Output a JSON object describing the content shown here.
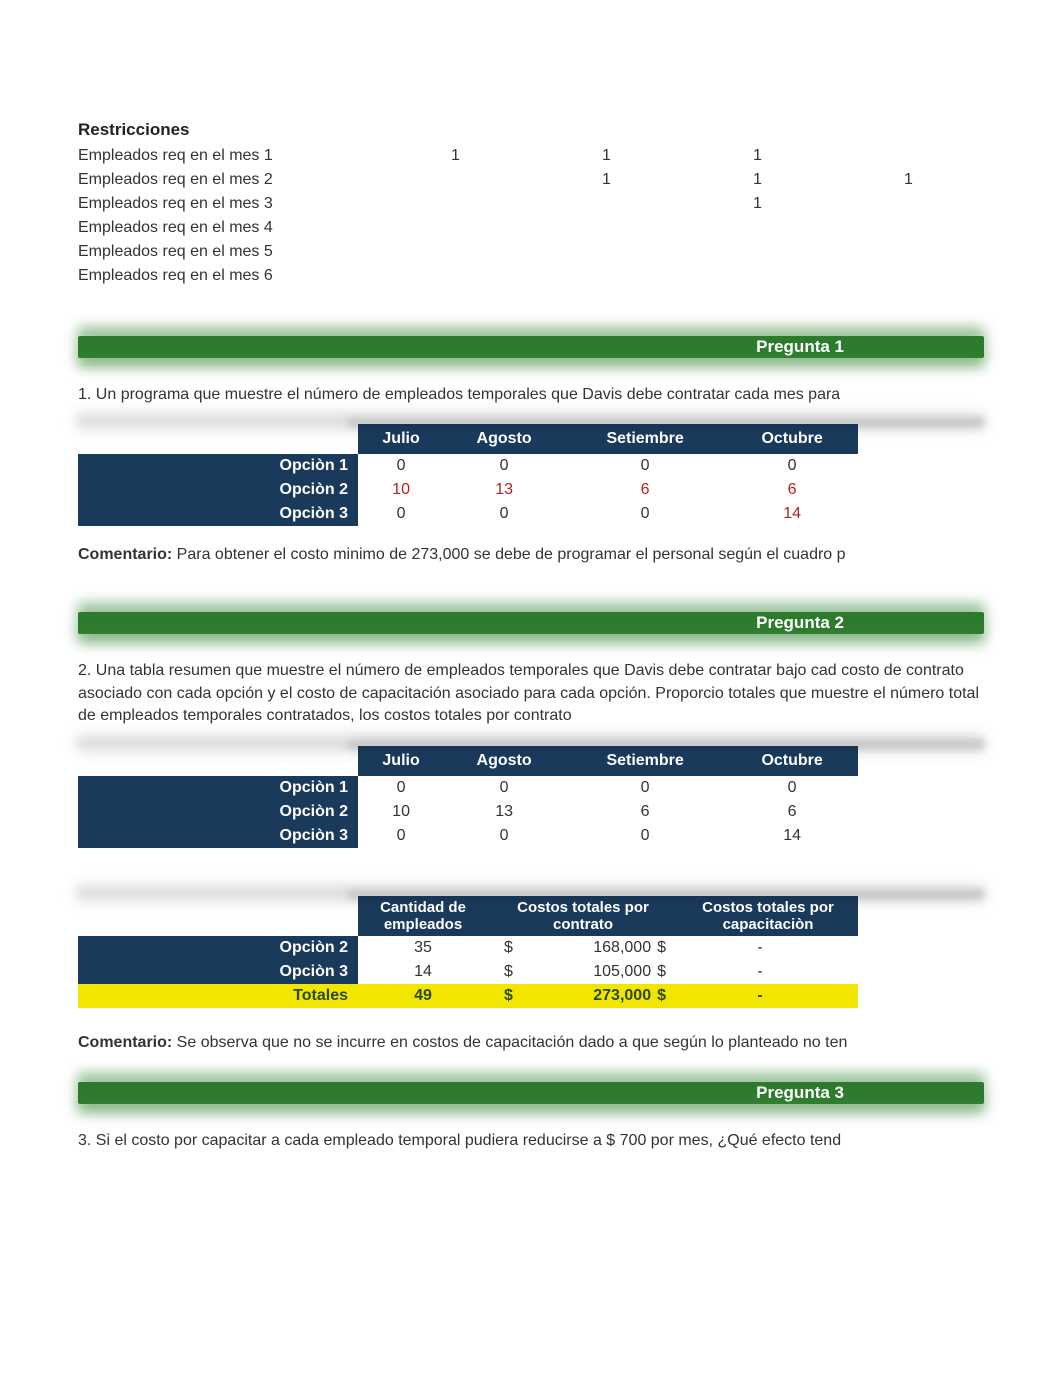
{
  "restricciones": {
    "title": "Restricciones",
    "rows": [
      {
        "label": "Empleados req en el mes 1",
        "c1": "1",
        "c2": "1",
        "c3": "1",
        "c4": ""
      },
      {
        "label": "Empleados req en el mes 2",
        "c1": "",
        "c2": "1",
        "c3": "1",
        "c4": "1"
      },
      {
        "label": "Empleados req en el mes 3",
        "c1": "",
        "c2": "",
        "c3": "1",
        "c4": ""
      },
      {
        "label": "Empleados req en el mes 4",
        "c1": "",
        "c2": "",
        "c3": "",
        "c4": ""
      },
      {
        "label": "Empleados req en el mes 5",
        "c1": "",
        "c2": "",
        "c3": "",
        "c4": ""
      },
      {
        "label": "Empleados req en el mes 6",
        "c1": "",
        "c2": "",
        "c3": "",
        "c4": ""
      }
    ]
  },
  "pregunta1": {
    "barLabel": "Pregunta 1",
    "text": "1. Un programa que muestre el número de empleados temporales que Davis debe contratar cada mes para",
    "headers": {
      "m1": "Julio",
      "m2": "Agosto",
      "m3": "Setiembre",
      "m4": "Octubre"
    },
    "rows": [
      {
        "label": "Opciòn 1",
        "m1": "0",
        "m2": "0",
        "m3": "0",
        "m4": "0",
        "highlight": false
      },
      {
        "label": "Opciòn 2",
        "m1": "10",
        "m2": "13",
        "m3": "6",
        "m4": "6",
        "highlight": true
      },
      {
        "label": "Opciòn 3",
        "m1": "0",
        "m2": "0",
        "m3": "0",
        "m4": "14",
        "highlight": false
      }
    ],
    "commentLabel": "Comentario:",
    "commentText": " Para obtener el costo minimo de 273,000 se debe de programar el personal según el cuadro p"
  },
  "pregunta2": {
    "barLabel": "Pregunta 2",
    "text": "2. Una tabla resumen que muestre el número de empleados temporales que Davis debe contratar bajo cad costo de contrato asociado con cada opción y el costo de capacitación asociado para cada opción. Proporcio totales que muestre el número total de empleados temporales contratados, los costos totales por contrato",
    "headers": {
      "m1": "Julio",
      "m2": "Agosto",
      "m3": "Setiembre",
      "m4": "Octubre"
    },
    "rows": [
      {
        "label": "Opciòn 1",
        "m1": "0",
        "m2": "0",
        "m3": "0",
        "m4": "0"
      },
      {
        "label": "Opciòn 2",
        "m1": "10",
        "m2": "13",
        "m3": "6",
        "m4": "6"
      },
      {
        "label": "Opciòn 3",
        "m1": "0",
        "m2": "0",
        "m3": "0",
        "m4": "14"
      }
    ],
    "summaryHeaders": {
      "h1": "Cantidad de empleados",
      "h2": "Costos totales por contrato",
      "h3": "Costos totales por capacitaciòn"
    },
    "summaryRows": [
      {
        "label": "Opciòn 2",
        "emp": "35",
        "contrato": "168,000",
        "cap": "-"
      },
      {
        "label": "Opciòn 3",
        "emp": "14",
        "contrato": "105,000",
        "cap": "-"
      }
    ],
    "totals": {
      "label": "Totales",
      "emp": "49",
      "contrato": "273,000",
      "cap": "-"
    },
    "currency": "$",
    "commentLabel": "Comentario:",
    "commentText": " Se observa que no se incurre en costos de capacitación dado a que según lo planteado no ten"
  },
  "pregunta3": {
    "barLabel": "Pregunta 3",
    "text": "3. Si el costo por capacitar a cada empleado temporal pudiera reducirse a $ 700 por mes, ¿Qué efecto tend"
  }
}
